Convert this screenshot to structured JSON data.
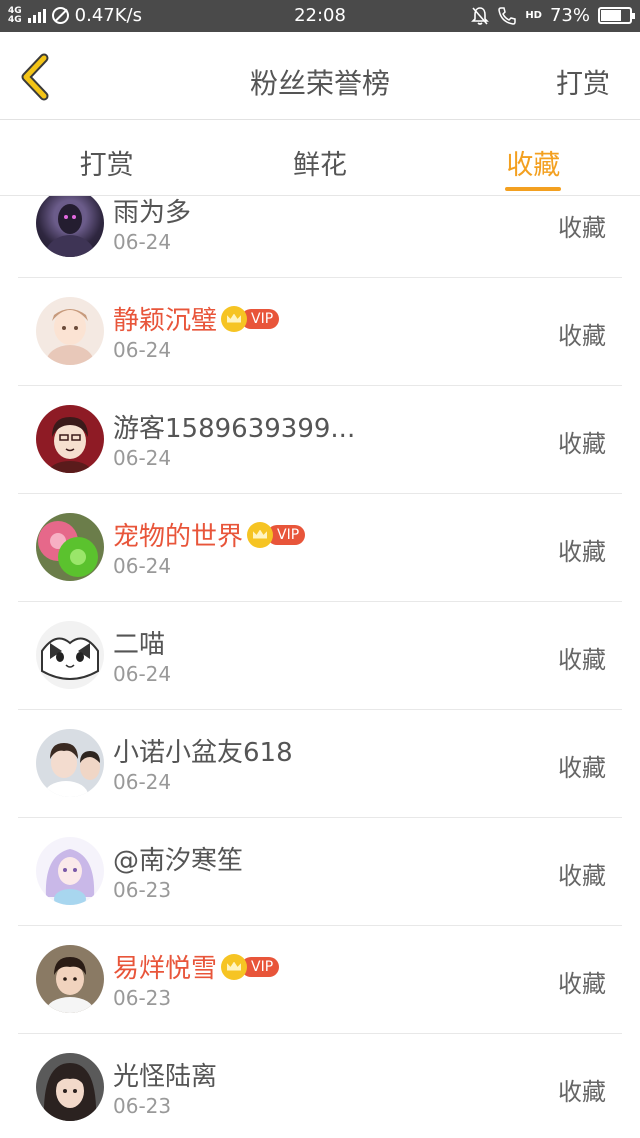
{
  "status_bar": {
    "network": "4G 4G",
    "speed": "0.47K/s",
    "time": "22:08",
    "hd": "HD",
    "battery": "73%",
    "battery_level": 0.73
  },
  "header": {
    "title": "粉丝荣誉榜",
    "action": "打赏"
  },
  "tabs": [
    {
      "label": "打赏",
      "active": false
    },
    {
      "label": "鲜花",
      "active": false
    },
    {
      "label": "收藏",
      "active": true
    }
  ],
  "colors": {
    "accent": "#f3a020",
    "vip_name": "#e8553a",
    "back_icon": "#f3c417"
  },
  "vip_label": "VIP",
  "rows": [
    {
      "name": "雨为多",
      "date": "06-24",
      "action": "收藏",
      "vip": false
    },
    {
      "name": "静颖沉璧",
      "date": "06-24",
      "action": "收藏",
      "vip": true
    },
    {
      "name": "游客1589639399...",
      "date": "06-24",
      "action": "收藏",
      "vip": false
    },
    {
      "name": "宠物的世界",
      "date": "06-24",
      "action": "收藏",
      "vip": true
    },
    {
      "name": "二喵",
      "date": "06-24",
      "action": "收藏",
      "vip": false
    },
    {
      "name": "小诺小盆友618",
      "date": "06-24",
      "action": "收藏",
      "vip": false
    },
    {
      "name": "@南汐寒笙",
      "date": "06-23",
      "action": "收藏",
      "vip": false
    },
    {
      "name": "易烊悦雪",
      "date": "06-23",
      "action": "收藏",
      "vip": true
    },
    {
      "name": "光怪陆离",
      "date": "06-23",
      "action": "收藏",
      "vip": false
    }
  ]
}
